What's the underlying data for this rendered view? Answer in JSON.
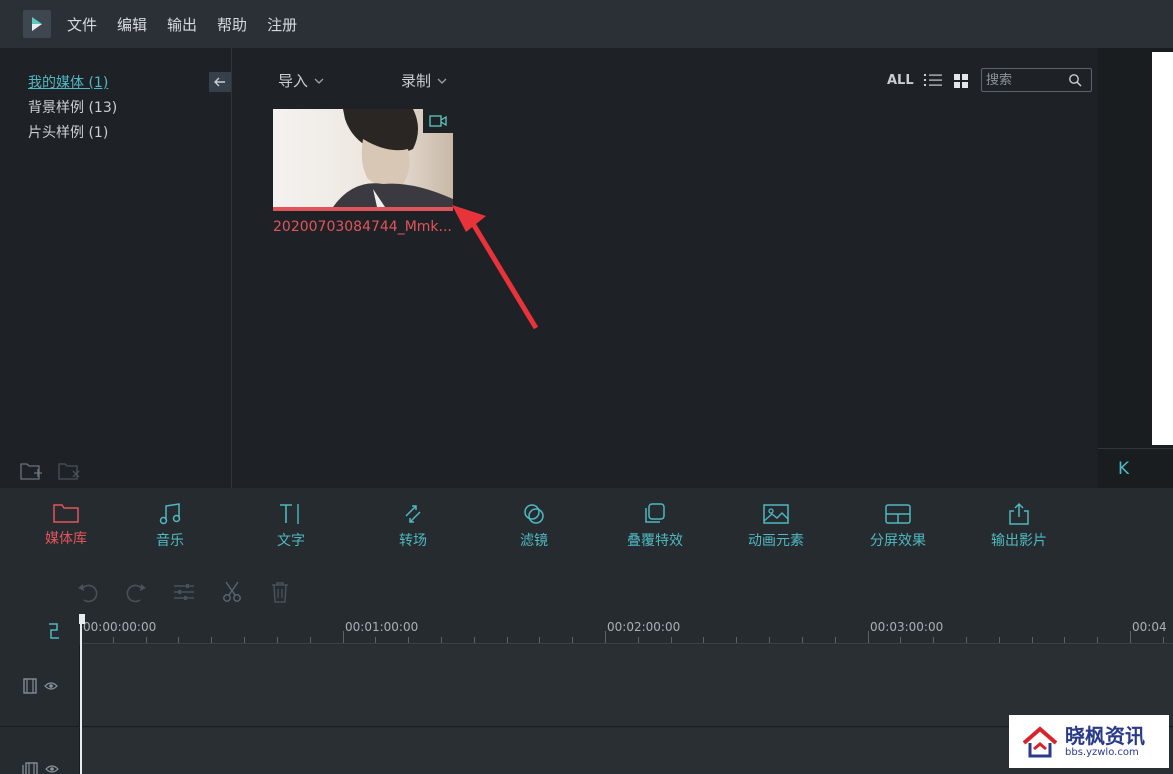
{
  "menu": {
    "items": [
      "文件",
      "编辑",
      "输出",
      "帮助",
      "注册"
    ]
  },
  "library": {
    "folders": [
      {
        "label": "我的媒体 (1)",
        "active": true
      },
      {
        "label": "背景样例 (13)",
        "active": false
      },
      {
        "label": "片头样例 (1)",
        "active": false
      }
    ]
  },
  "media": {
    "import_label": "导入",
    "record_label": "录制",
    "all_label": "ALL",
    "search_placeholder": "搜索",
    "clip_name": "20200703084744_Mmk..."
  },
  "preview": {
    "ctrl_label": "K"
  },
  "tools": [
    {
      "label": "媒体库",
      "icon": "folder-icon",
      "active": true
    },
    {
      "label": "音乐",
      "icon": "music-icon",
      "active": false
    },
    {
      "label": "文字",
      "icon": "text-icon",
      "active": false
    },
    {
      "label": "转场",
      "icon": "transition-icon",
      "active": false
    },
    {
      "label": "滤镜",
      "icon": "filter-icon",
      "active": false
    },
    {
      "label": "叠覆特效",
      "icon": "overlay-icon",
      "active": false
    },
    {
      "label": "动画元素",
      "icon": "image-icon",
      "active": false
    },
    {
      "label": "分屏效果",
      "icon": "split-screen-icon",
      "active": false
    },
    {
      "label": "输出影片",
      "icon": "export-icon",
      "active": false
    }
  ],
  "timeline": {
    "times": [
      "00:00:00:00",
      "00:01:00:00",
      "00:02:00:00",
      "00:03:00:00",
      "00:04"
    ]
  },
  "watermark": {
    "name": "晓枫资讯",
    "url": "bbs.yzwlo.com"
  },
  "colors": {
    "accent": "#4fb8c0",
    "active": "#e0555a",
    "background": "#1e2226"
  }
}
